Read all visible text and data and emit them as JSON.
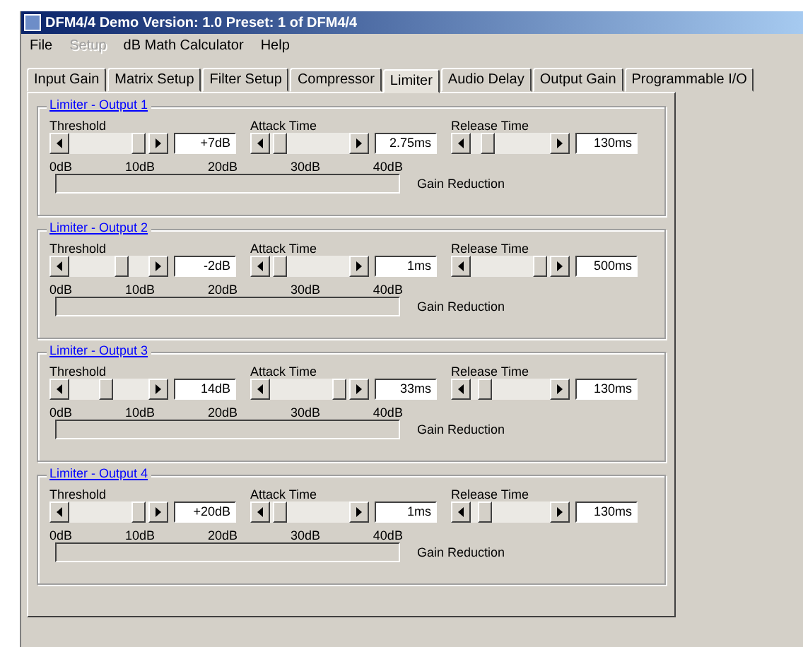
{
  "window": {
    "title": "DFM4/4 Demo Version: 1.0 Preset: 1 of DFM4/4"
  },
  "menu": [
    {
      "label": "File",
      "disabled": false
    },
    {
      "label": "Setup",
      "disabled": true
    },
    {
      "label": "dB Math Calculator",
      "disabled": false
    },
    {
      "label": "Help",
      "disabled": false
    }
  ],
  "tabs": [
    {
      "label": "Input Gain",
      "selected": false
    },
    {
      "label": "Matrix Setup",
      "selected": false
    },
    {
      "label": "Filter Setup",
      "selected": false
    },
    {
      "label": "Compressor",
      "selected": false
    },
    {
      "label": "Limiter",
      "selected": true
    },
    {
      "label": "Audio Delay",
      "selected": false
    },
    {
      "label": "Output Gain",
      "selected": false
    },
    {
      "label": "Programmable I/O",
      "selected": false
    }
  ],
  "groups": [
    {
      "title": "Limiter - Output 1",
      "controls": [
        {
          "label": "Threshold",
          "level": 0.95,
          "value": "+7dB"
        },
        {
          "label": "Attack Time",
          "level": 0.05,
          "value": "2.75ms"
        },
        {
          "label": "Release Time",
          "level": 0.15,
          "value": "130ms"
        }
      ],
      "scale": [
        "0dB",
        "10dB",
        "20dB",
        "30dB",
        "40dB"
      ],
      "meter": {
        "label": "Gain Reduction",
        "level": 0
      }
    },
    {
      "title": "Limiter - Output 2",
      "controls": [
        {
          "label": "Threshold",
          "level": 0.7,
          "value": "-2dB"
        },
        {
          "label": "Attack Time",
          "level": 0.05,
          "value": "1ms"
        },
        {
          "label": "Release Time",
          "level": 0.95,
          "value": "500ms"
        }
      ],
      "scale": [
        "0dB",
        "10dB",
        "20dB",
        "30dB",
        "40dB"
      ],
      "meter": {
        "label": "Gain Reduction",
        "level": 0
      }
    },
    {
      "title": "Limiter - Output 3",
      "controls": [
        {
          "label": "Threshold",
          "level": 0.45,
          "value": "14dB"
        },
        {
          "label": "Attack Time",
          "level": 0.95,
          "value": "33ms"
        },
        {
          "label": "Release Time",
          "level": 0.1,
          "value": "130ms"
        }
      ],
      "scale": [
        "0dB",
        "10dB",
        "20dB",
        "30dB",
        "40dB"
      ],
      "meter": {
        "label": "Gain Reduction",
        "level": 0
      }
    },
    {
      "title": "Limiter - Output 4",
      "controls": [
        {
          "label": "Threshold",
          "level": 0.95,
          "value": "+20dB"
        },
        {
          "label": "Attack Time",
          "level": 0.05,
          "value": "1ms"
        },
        {
          "label": "Release Time",
          "level": 0.1,
          "value": "130ms"
        }
      ],
      "scale": [
        "0dB",
        "10dB",
        "20dB",
        "30dB",
        "40dB"
      ],
      "meter": {
        "label": "Gain Reduction",
        "level": 0
      }
    }
  ]
}
